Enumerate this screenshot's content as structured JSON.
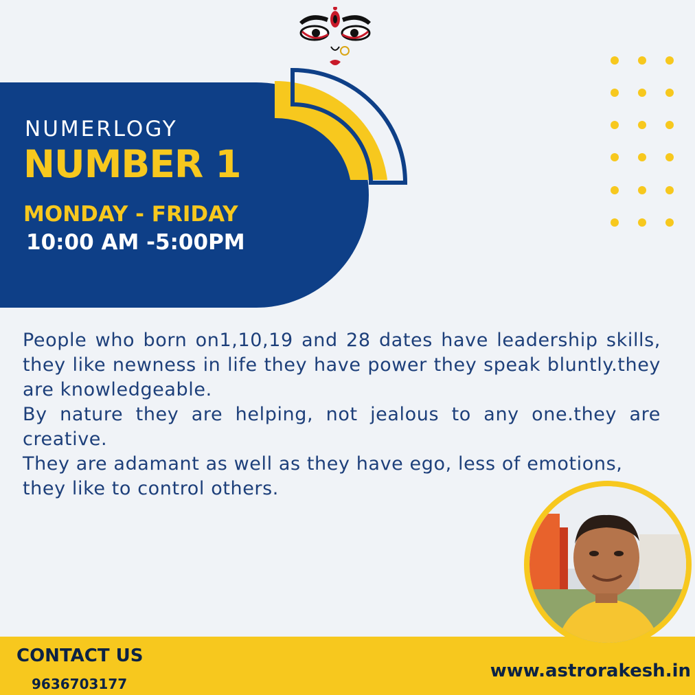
{
  "heading": {
    "small": "NUMERLOGY",
    "big": "NUMBER 1"
  },
  "schedule": {
    "days": "MONDAY - FRIDAY",
    "hours": "10:00 AM -5:00PM"
  },
  "description": {
    "paragraphs": [
      "People who born on1,10,19 and 28 dates have leadership skills, they like newness in life they have power they speak bluntly.they are knowledgeable.",
      "By nature they are helping, not jealous  to any one.they are creative.",
      "They are adamant as well as they have ego, less of emotions, they like to control  others."
    ]
  },
  "footer": {
    "contact_label": "CONTACT US",
    "phone": "9636703177",
    "website": "www.astrorakesh.in"
  },
  "icons": {
    "header": "deity-face-icon",
    "profile": "astrologer-photo"
  },
  "colors": {
    "navy": "#0e3f87",
    "yellow": "#f7c81e",
    "background": "#f0f3f7",
    "text": "#1d3f7a"
  }
}
